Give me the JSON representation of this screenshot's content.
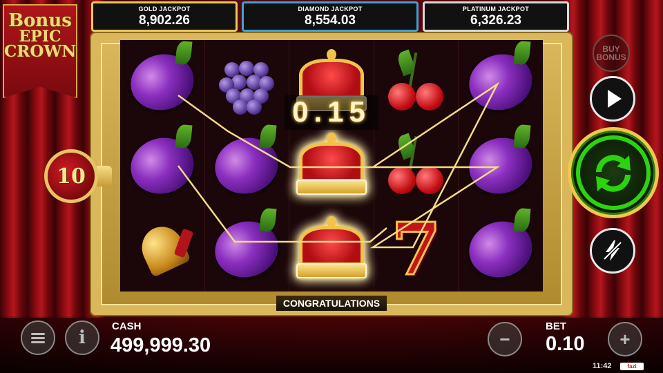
{
  "game": {
    "logo_line1": "Bonus",
    "logo_line2": "EPIC",
    "logo_line3": "CROWN"
  },
  "jackpots": [
    {
      "label": "GOLD JACKPOT",
      "value": "8,902.26",
      "color": "#e8c95a"
    },
    {
      "label": "DIAMOND JACKPOT",
      "value": "8,554.03",
      "color": "#3aa3d9"
    },
    {
      "label": "PLATINUM JACKPOT",
      "value": "6,326.23",
      "color": "#d8d8d8"
    }
  ],
  "reels": [
    [
      "plum",
      "plum",
      "bell"
    ],
    [
      "grapes",
      "plum",
      "plum"
    ],
    [
      "crown",
      "crown-win",
      "crown-win"
    ],
    [
      "cherry",
      "cherry",
      "seven"
    ],
    [
      "plum",
      "plum",
      "plum"
    ]
  ],
  "win": {
    "amount": "0.15",
    "message": "CONGRATULATIONS"
  },
  "lines": {
    "count": "10"
  },
  "controls": {
    "buy_bonus_line1": "BUY",
    "buy_bonus_line2": "BONUS",
    "play_icon": "play-icon",
    "spin_icon": "refresh-arrows-icon",
    "turbo_icon": "lightning-off-icon",
    "menu_icon": "hamburger-menu-icon",
    "info_icon": "info-icon",
    "info_glyph": "i",
    "minus_glyph": "−",
    "plus_glyph": "+"
  },
  "account": {
    "cash_label": "CASH",
    "cash_value": "499,999.30",
    "bet_label": "BET",
    "bet_value": "0.10"
  },
  "status": {
    "clock": "11:42",
    "brand": "fazi"
  },
  "colors": {
    "spin_green": "#2bd40e",
    "frame_gold": "#d9b75a",
    "curtain_red": "#8d0c12"
  }
}
